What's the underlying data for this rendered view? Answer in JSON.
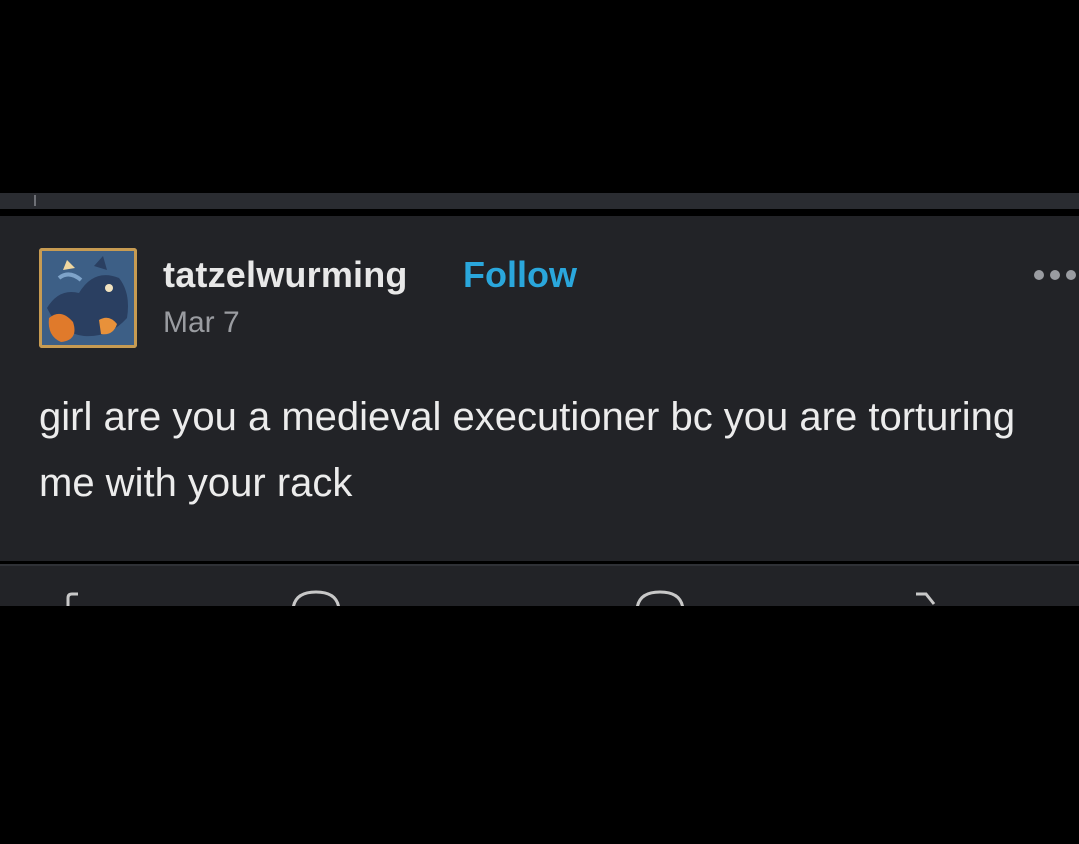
{
  "post": {
    "username": "tatzelwurming",
    "follow_label": "Follow",
    "date": "Mar 7",
    "body": "girl are you a medieval executioner bc you are torturing me with your rack",
    "more_icon": "ellipsis-icon",
    "avatar": "avatar-illustration"
  },
  "actions": {
    "icons": [
      "share-icon",
      "comment-icon",
      "reblog-icon",
      "like-icon"
    ]
  },
  "colors": {
    "background": "#000000",
    "card": "#222327",
    "username": "#e8e8e8",
    "follow": "#2aa7dc",
    "date": "#9a9ca1",
    "body": "#ececec"
  }
}
